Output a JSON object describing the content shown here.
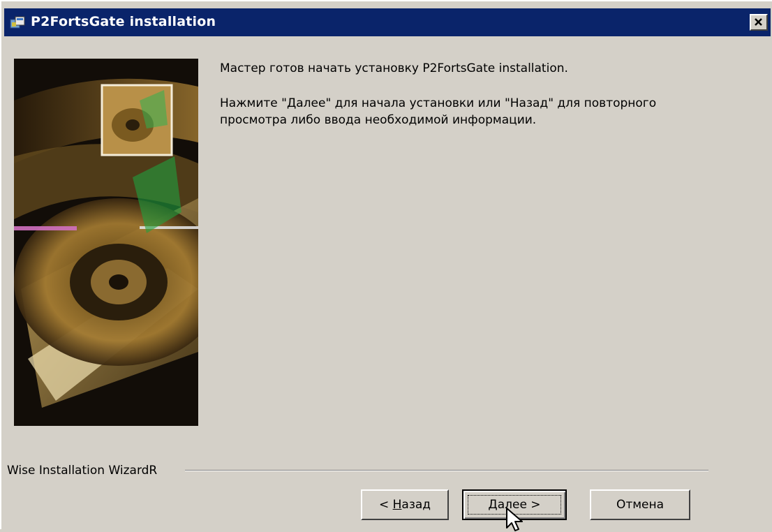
{
  "window": {
    "title": "P2FortsGate installation",
    "icon": "installer-icon",
    "close_icon": "close-icon"
  },
  "content": {
    "line1": "Мастер готов начать установку P2FortsGate installation.",
    "line2": "Нажмите \"Далее\" для начала установки или \"Назад\" для повторного просмотра либо ввода необходимой информации."
  },
  "footer": {
    "brand": "Wise Installation WizardR"
  },
  "buttons": {
    "back": {
      "prefix": "< ",
      "mnemonic": "Н",
      "rest": "азад"
    },
    "next": {
      "mnemonic": "Д",
      "rest": "алее",
      "suffix": " >"
    },
    "cancel": "Отмена"
  },
  "colors": {
    "titlebar": "#0a246a",
    "dialog_bg": "#d4d0c8"
  }
}
